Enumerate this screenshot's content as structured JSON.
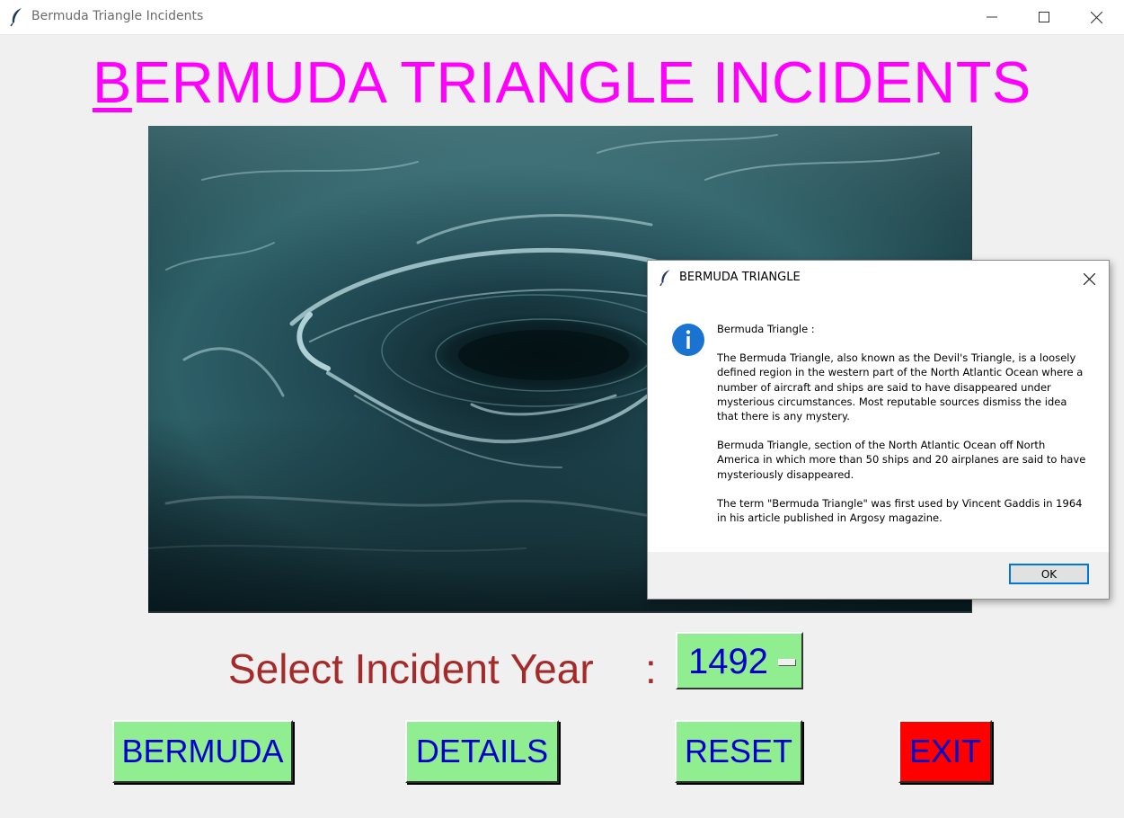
{
  "window": {
    "title": "Bermuda Triangle Incidents",
    "icon": "feather-icon"
  },
  "heading": {
    "first_letter": "B",
    "rest": "ERMUDA TRIANGLE INCIDENTS",
    "color": "#ff00ff"
  },
  "year_selector": {
    "label": "Select Incident Year",
    "colon": ":",
    "value": "1492"
  },
  "buttons": {
    "bermuda": "BERMUDA",
    "details": "DETAILS",
    "reset": "RESET",
    "exit": "EXIT"
  },
  "dialog": {
    "title": "BERMUDA TRIANGLE",
    "icon": "info-icon",
    "paragraphs": [
      "Bermuda Triangle :",
      "The Bermuda Triangle, also known as the Devil's Triangle, is a loosely defined region in the western part of the North Atlantic Ocean where a number of aircraft and ships are said to have disappeared under mysterious circumstances. Most reputable sources dismiss the idea that there is any mystery.",
      "Bermuda Triangle, section of the North Atlantic Ocean off North America in which more than 50 ships and 20 airplanes are said to have mysteriously disappeared.",
      "The term \"Bermuda Triangle\" was first used by Vincent Gaddis in 1964 in his article published in Argosy magazine."
    ],
    "ok_label": "OK"
  },
  "colors": {
    "button_green": "#90ee90",
    "exit_red": "#ff0000",
    "button_text": "#0000cc",
    "label_brown": "#a52a2a"
  }
}
